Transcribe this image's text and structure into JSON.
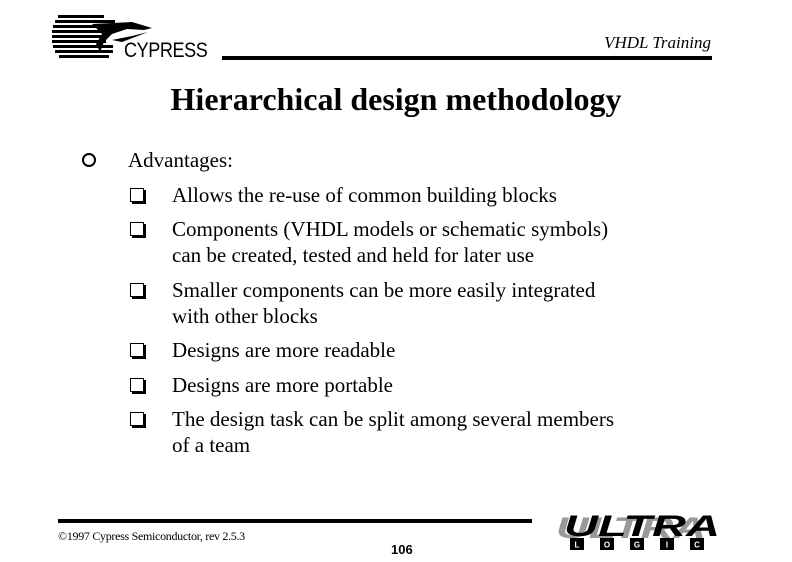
{
  "header": {
    "company_logo_text": "CYPRESS",
    "course_label": "VHDL Training"
  },
  "slide": {
    "title": "Hierarchical design methodology",
    "level1": {
      "icon": "circle-bullet-icon",
      "text": "Advantages:"
    },
    "items": [
      {
        "icon": "checkbox-bullet-icon",
        "lines": [
          "Allows the re-use of common building blocks"
        ]
      },
      {
        "icon": "checkbox-bullet-icon",
        "lines": [
          "Components (VHDL models or schematic symbols)",
          "can be created, tested and held for later use"
        ]
      },
      {
        "icon": "checkbox-bullet-icon",
        "lines": [
          "Smaller components can be more easily integrated",
          "with other blocks"
        ]
      },
      {
        "icon": "checkbox-bullet-icon",
        "lines": [
          "Designs are more readable"
        ]
      },
      {
        "icon": "checkbox-bullet-icon",
        "lines": [
          "Designs are more portable"
        ]
      },
      {
        "icon": "checkbox-bullet-icon",
        "lines": [
          "The design task can be split among several members",
          "of a team"
        ]
      }
    ]
  },
  "footer": {
    "copyright": "©1997 Cypress Semiconductor, rev 2.5.3",
    "page_number": "106",
    "ultra_logo_text": "ULTRA",
    "logic_letters": [
      "L",
      "O",
      "G",
      "I",
      "C"
    ]
  }
}
